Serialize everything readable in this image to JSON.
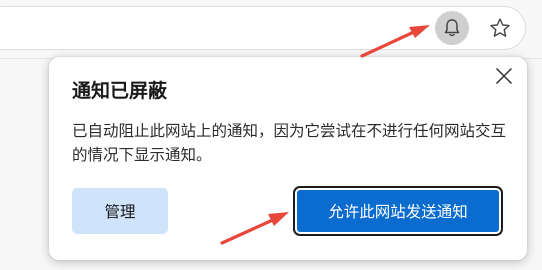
{
  "toolbar": {
    "bell_icon": "notification-blocked-bell-icon",
    "star_icon": "favorite-star-icon"
  },
  "popup": {
    "title": "通知已屏蔽",
    "description": "已自动阻止此网站上的通知，因为它尝试在不进行任何网站交互的情况下显示通知。",
    "manage_label": "管理",
    "allow_label": "允许此网站发送通知",
    "close_icon": "close-icon"
  },
  "colors": {
    "accent": "#0a6ccf",
    "secondary_button": "#cfe3fb",
    "annotation": "#e8483b"
  }
}
